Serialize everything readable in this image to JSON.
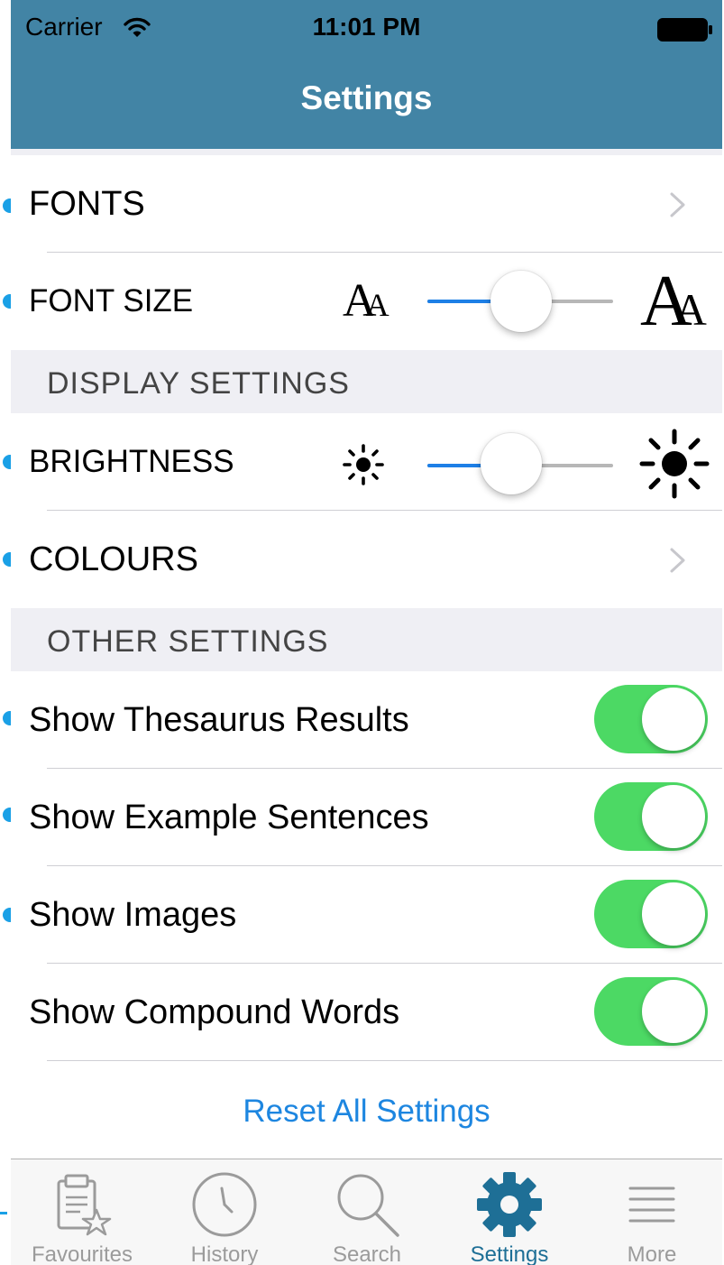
{
  "status_bar": {
    "carrier": "Carrier",
    "time": "11:01 PM"
  },
  "nav": {
    "title": "Settings"
  },
  "rows": {
    "fonts": "FONTS",
    "font_size": "FONT SIZE",
    "brightness": "BRIGHTNESS",
    "colours": "COLOURS",
    "thesaurus": "Show Thesaurus Results",
    "examples": "Show Example Sentences",
    "images": "Show Images",
    "compound": "Show Compound Words"
  },
  "sections": {
    "display": "DISPLAY SETTINGS",
    "other": "OTHER SETTINGS"
  },
  "controls": {
    "font_size_level": 0.39,
    "brightness_level": 0.33,
    "toggles": {
      "thesaurus": true,
      "examples": true,
      "images": true,
      "compound": true
    }
  },
  "reset_label": "Reset All Settings",
  "tabs": [
    {
      "label": "Favourites",
      "icon": "clipboard-star-icon"
    },
    {
      "label": "History",
      "icon": "clock-icon"
    },
    {
      "label": "Search",
      "icon": "magnifier-icon"
    },
    {
      "label": "Settings",
      "icon": "gear-icon"
    },
    {
      "label": "More",
      "icon": "menu-lines-icon"
    }
  ],
  "colors": {
    "header": "#4284a5",
    "accent": "#1d86e0",
    "toggle_on": "#4cd964",
    "tab_active": "#1e6f96"
  }
}
